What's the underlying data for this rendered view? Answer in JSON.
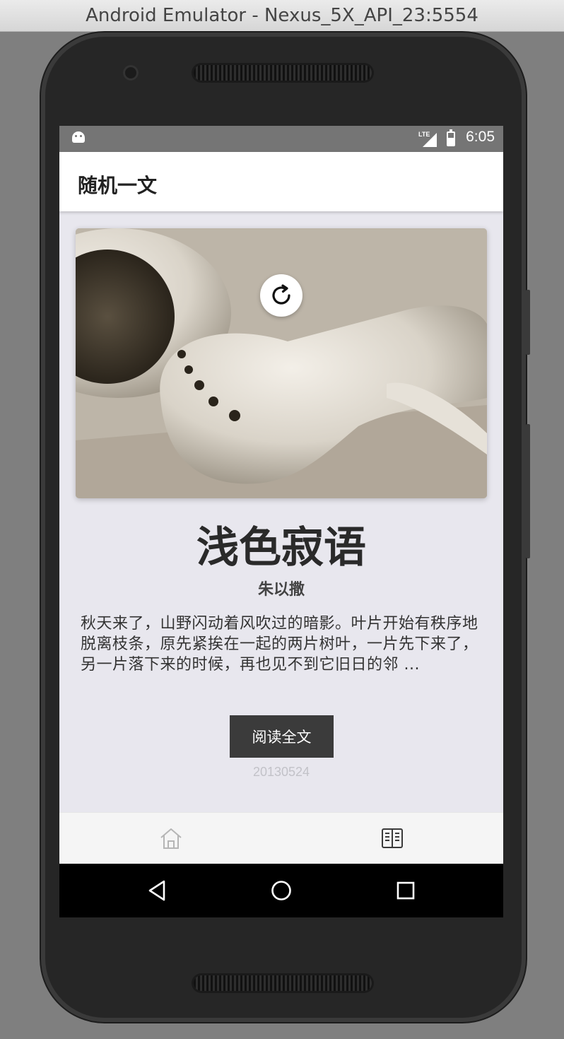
{
  "window": {
    "title": "Android Emulator - Nexus_5X_API_23:5554"
  },
  "status_bar": {
    "network": "LTE",
    "time": "6:05",
    "icons": [
      "android-debug-icon",
      "signal-icon",
      "battery-icon"
    ]
  },
  "app_bar": {
    "title": "随机一文"
  },
  "article": {
    "title": "浅色寂语",
    "author": "朱以撒",
    "excerpt": "秋天来了，山野闪动着风吹过的暗影。叶片开始有秩序地脱离枝条，原先紧挨在一起的两片树叶，一片先下来了，另一片落下来的时候，再也见不到它旧日的邻 ...",
    "date": "20130524",
    "read_button_label": "阅读全文"
  },
  "cover_image": {
    "subject": "earbud headphones photo",
    "overlay_icon": "refresh-icon"
  },
  "bottom_tabs": [
    {
      "icon": "home-icon",
      "active": false
    },
    {
      "icon": "book-icon",
      "active": true
    }
  ],
  "nav_bar": {
    "icons": [
      "back-icon",
      "home-circle-icon",
      "recents-icon"
    ]
  },
  "colors": {
    "screen_bg": "#e8e7ee",
    "status_bar": "#757575",
    "button_bg": "#3b3b3b",
    "date_text": "#c2c2c8"
  }
}
